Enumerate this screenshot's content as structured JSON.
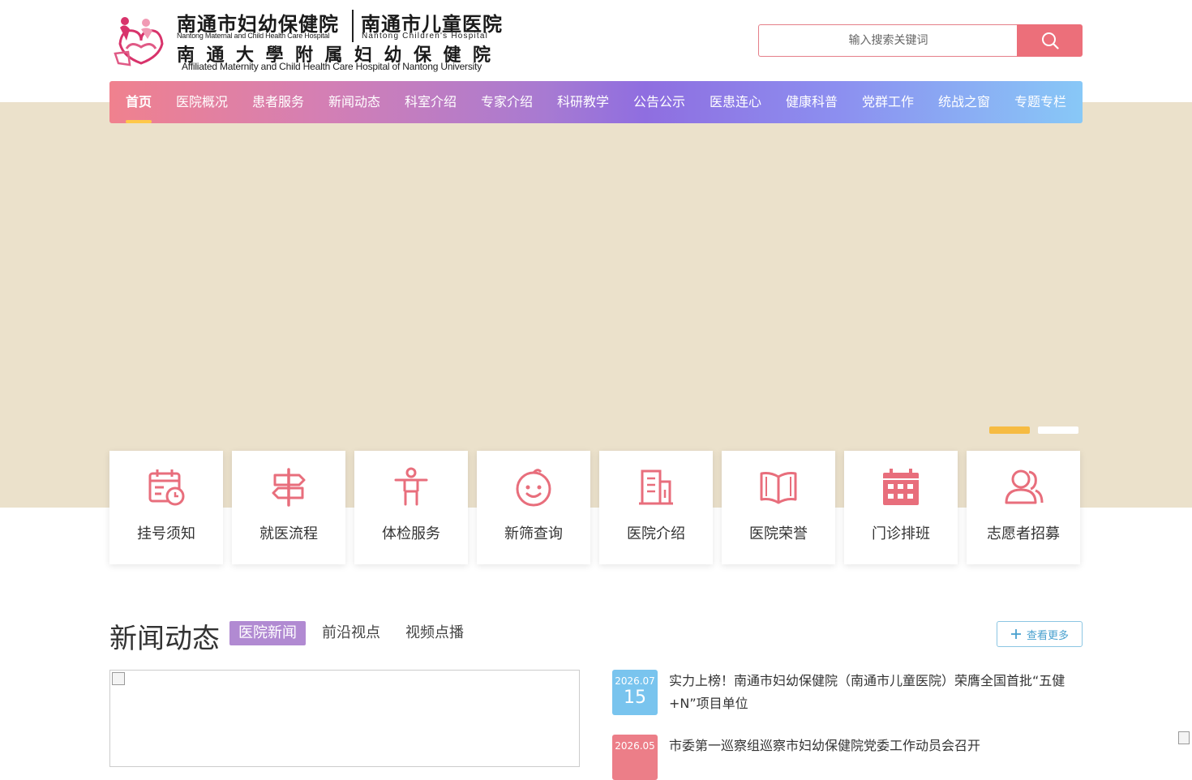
{
  "logo": {
    "cn_maternal": "南通市妇幼保健院",
    "en_maternal": "Nantong Maternal and Child Health Care Hospital",
    "cn_children": "南通市儿童医院",
    "en_children": "Nantong Children's Hospital",
    "cn_affiliated": "南通大學附属妇幼保健院",
    "en_affiliated": "Affiliated Maternity and Child Health Care Hospital of Nantong University"
  },
  "search": {
    "placeholder": "输入搜索关键词",
    "icon": "search-icon"
  },
  "colors": {
    "accent_pink": "#ec6f7a",
    "nav_gradient_start": "#f0818e",
    "nav_gradient_mid": "#8f6ee0",
    "nav_gradient_end": "#88c8f7",
    "active_underline": "#ffc84a",
    "banner_bg": "#ebe1cb",
    "tab_active": "#b18ad2",
    "date_blue": "#79c4ee",
    "date_pink": "#ec7e88"
  },
  "nav": {
    "items": [
      {
        "label": "首页",
        "active": true
      },
      {
        "label": "医院概况"
      },
      {
        "label": "患者服务"
      },
      {
        "label": "新闻动态"
      },
      {
        "label": "科室介绍"
      },
      {
        "label": "专家介绍"
      },
      {
        "label": "科研教学"
      },
      {
        "label": "公告公示"
      },
      {
        "label": "医患连心"
      },
      {
        "label": "健康科普"
      },
      {
        "label": "党群工作"
      },
      {
        "label": "统战之窗"
      },
      {
        "label": "专题专栏"
      }
    ]
  },
  "banner": {
    "slide_count": 2,
    "active_slide": 1
  },
  "quick_links": [
    {
      "label": "挂号须知",
      "icon": "calendar-clock-icon"
    },
    {
      "label": "就医流程",
      "icon": "signpost-icon"
    },
    {
      "label": "体检服务",
      "icon": "person-icon"
    },
    {
      "label": "新筛查询",
      "icon": "baby-face-icon"
    },
    {
      "label": "医院介绍",
      "icon": "building-icon"
    },
    {
      "label": "医院荣誉",
      "icon": "open-book-icon"
    },
    {
      "label": "门诊排班",
      "icon": "calendar-grid-icon"
    },
    {
      "label": "志愿者招募",
      "icon": "people-icon"
    }
  ],
  "news": {
    "title": "新闻动态",
    "tabs": [
      {
        "label": "医院新闻",
        "active": true
      },
      {
        "label": "前沿视点"
      },
      {
        "label": "视频点播"
      }
    ],
    "more_label": "查看更多",
    "items": [
      {
        "ym": "2026.07",
        "day": "15",
        "title": "实力上榜！南通市妇幼保健院（南通市儿童医院）荣膺全国首批“五健+N”项目单位"
      },
      {
        "ym": "2026.05",
        "day": "",
        "title": "市委第一巡察组巡察市妇幼保健院党委工作动员会召开"
      }
    ]
  }
}
